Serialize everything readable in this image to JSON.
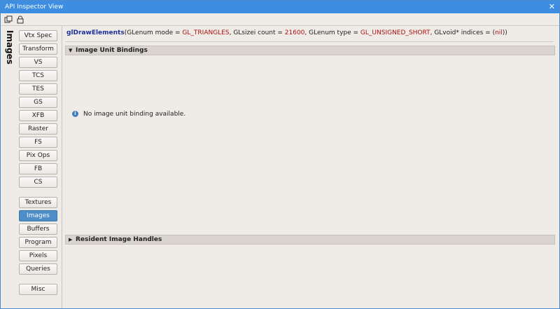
{
  "window": {
    "title": "API Inspector View",
    "close_glyph": "✕"
  },
  "toolbar": {
    "icons": [
      "copy-icon",
      "lock-icon"
    ]
  },
  "sidebar": {
    "title": "Images",
    "stage_buttons": [
      "Vtx Spec",
      "Transform",
      "VS",
      "TCS",
      "TES",
      "GS",
      "XFB",
      "Raster",
      "FS",
      "Pix Ops",
      "FB",
      "CS"
    ],
    "resource_buttons": [
      "Textures",
      "Images",
      "Buffers",
      "Program",
      "Pixels",
      "Queries"
    ],
    "misc_button": "Misc",
    "active": "Images"
  },
  "call": {
    "function": "glDrawElements",
    "p1": "(GLenum mode = ",
    "mode": "GL_TRIANGLES",
    "p2": ", GLsizei count = ",
    "count": "21600",
    "p3": ", GLenum type = ",
    "type": "GL_UNSIGNED_SHORT",
    "p4": ", GLvoid* indices = (",
    "indices": "nil",
    "p5": "))"
  },
  "sections": {
    "image_unit_bindings": {
      "label": "Image Unit Bindings",
      "expanded": true,
      "message": "No image unit binding available."
    },
    "resident_image_handles": {
      "label": "Resident Image Handles",
      "expanded": false
    }
  },
  "colors": {
    "accent": "#3d8ee3",
    "active_button": "#4d8ec9",
    "function_name": "#1c2f9a",
    "enum_value": "#aa1111"
  }
}
